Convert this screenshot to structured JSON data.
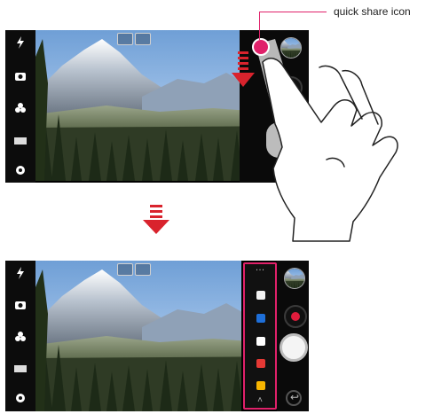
{
  "callout": {
    "label": "quick share icon",
    "color": "#e0216a"
  },
  "left_bar_icons": [
    "flash-icon",
    "switch-camera-icon",
    "effects-icon",
    "aspect-ratio-icon",
    "settings-icon"
  ],
  "mode_chips": [
    "landscape-mode-icon",
    "photo-mode-icon"
  ],
  "share_panel": {
    "more_label": "…",
    "apps": [
      {
        "name": "photos-app-icon",
        "color": "#f2f2f2"
      },
      {
        "name": "bluetooth-app-icon",
        "color": "#1e6fd9"
      },
      {
        "name": "edit-app-icon",
        "color": "#ffffff"
      },
      {
        "name": "email-app-icon",
        "color": "#e53935"
      },
      {
        "name": "memo-app-icon",
        "color": "#f7b500"
      }
    ],
    "collapse_label": "˄"
  },
  "colors": {
    "accent": "#e0216a",
    "record": "#e01c3c",
    "arrow": "#d9232d"
  }
}
